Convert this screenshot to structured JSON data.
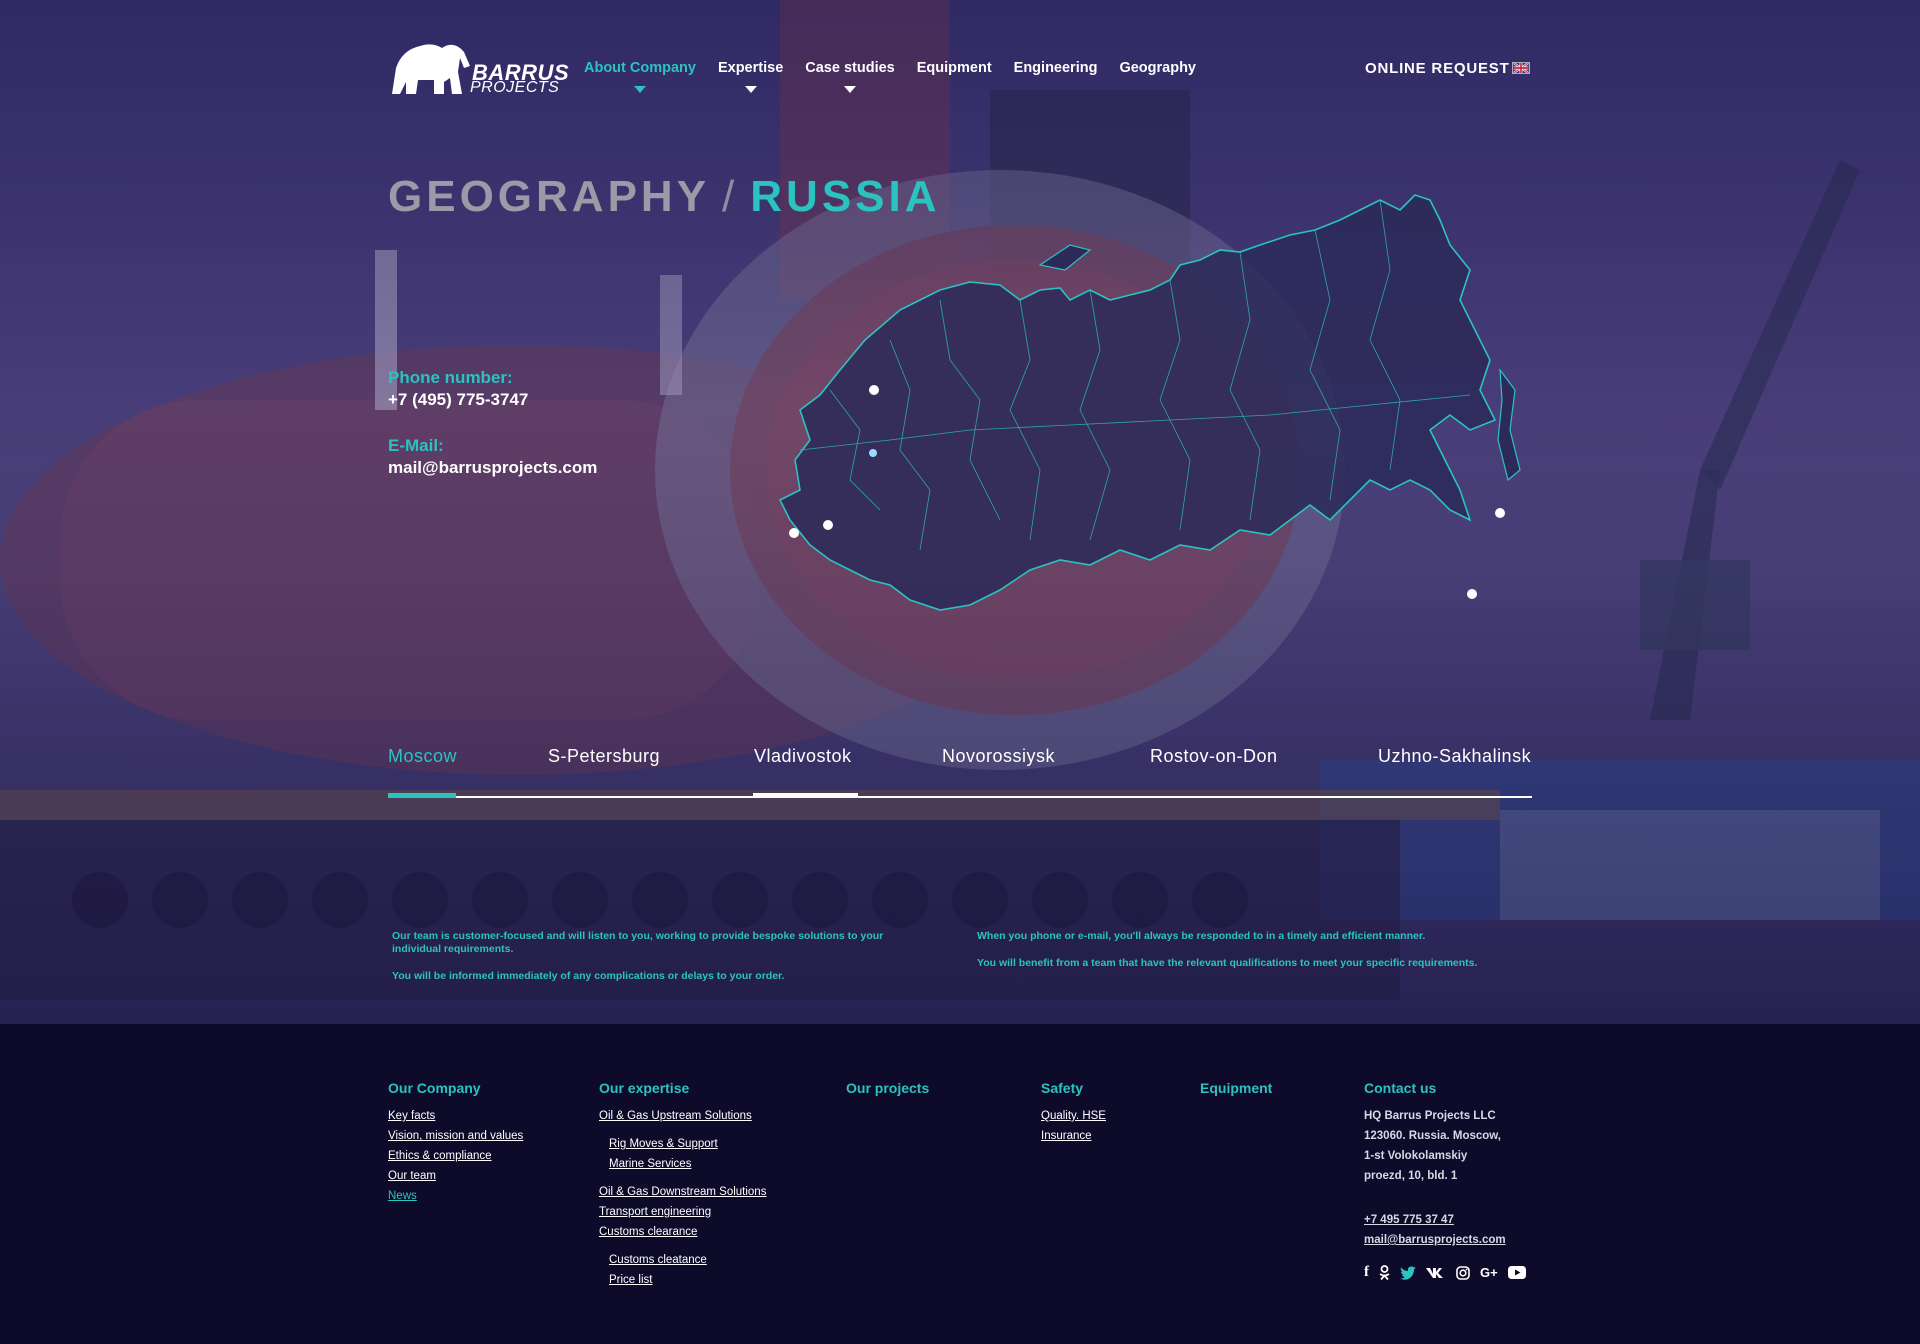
{
  "nav": {
    "logo_line1": "BARRUS",
    "logo_line2": "PROJECTS",
    "items": [
      {
        "label": "About Company",
        "active": true,
        "dropdown": true
      },
      {
        "label": "Expertise",
        "active": false,
        "dropdown": true
      },
      {
        "label": "Case studies",
        "active": false,
        "dropdown": true
      },
      {
        "label": "Equipment",
        "active": false,
        "dropdown": false
      },
      {
        "label": "Engineering",
        "active": false,
        "dropdown": false
      },
      {
        "label": "Geography",
        "active": false,
        "dropdown": false
      }
    ],
    "online_request": "ONLINE REQUEST",
    "language_icon": "uk-flag-icon"
  },
  "title": {
    "main": "GEOGRAPHY",
    "separator": "/",
    "sub": "RUSSIA"
  },
  "contacts": {
    "phone_label": "Phone number:",
    "phone": "+7 (495) 775-3747",
    "email_label": "E-Mail:",
    "email": "mail@barrusprojects.com"
  },
  "map": {
    "region": "russia-map",
    "markers": 6
  },
  "tabs": [
    {
      "label": "Moscow",
      "active": true
    },
    {
      "label": "S-Petersburg",
      "active": false
    },
    {
      "label": "Vladivostok",
      "active": false,
      "hover": true
    },
    {
      "label": "Novorossiysk",
      "active": false
    },
    {
      "label": "Rostov-on-Don",
      "active": false
    },
    {
      "label": "Uzhno-Sakhalinsk",
      "active": false
    }
  ],
  "info": {
    "left_1": "Our team is customer-focused and will listen to you, working to provide bespoke solutions to your individual requirements.",
    "left_2": "You will be informed immediately of any complications or delays to your order.",
    "right_1": "When you phone or e-mail, you'll always be responded to in a timely and efficient manner.",
    "right_2": "You will benefit from a team that have the relevant qualifications to meet your specific requirements."
  },
  "footer": {
    "company": {
      "heading": "Our Company",
      "links": [
        "Key facts",
        "Vision, mission and values",
        "Ethics & compliance",
        "Our team",
        "News"
      ]
    },
    "expertise": {
      "heading": "Our expertise",
      "links": [
        "Oil & Gas Upstream Solutions",
        "Rig Moves & Support",
        "Marine Services",
        "Oil & Gas Downstream Solutions",
        "Transport engineering",
        "Customs clearance",
        "Customs cleatance",
        "Price list"
      ]
    },
    "projects": {
      "heading": "Our projects"
    },
    "safety": {
      "heading": "Safety",
      "links": [
        "Quality. HSE",
        "Insurance"
      ]
    },
    "equipment": {
      "heading": "Equipment"
    },
    "contact": {
      "heading": "Contact us",
      "address": [
        "HQ Barrus Projects LLC",
        "123060. Russia. Moscow,",
        "1-st Volokolamskiy",
        "proezd, 10, bld. 1"
      ],
      "phone": "+7 495 775 37 47",
      "email": "mail@barrusprojects.com",
      "social": [
        "f",
        "ok",
        "tw",
        "vk",
        "ig",
        "G+",
        "yt"
      ]
    }
  },
  "colors": {
    "accent": "#2bc3c0",
    "footer_bg": "#0e0b2a"
  }
}
